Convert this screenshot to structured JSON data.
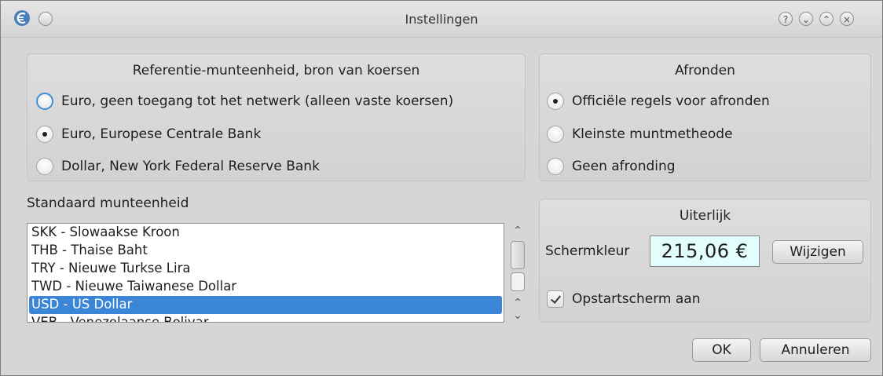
{
  "window": {
    "title": "Instellingen"
  },
  "titlebar_buttons": [
    {
      "name": "help",
      "glyph": "?"
    },
    {
      "name": "minimize",
      "glyph": "⌄"
    },
    {
      "name": "maximize",
      "glyph": "⌃"
    },
    {
      "name": "close",
      "glyph": "×"
    }
  ],
  "reference_group": {
    "title": "Referentie-munteenheid, bron van koersen",
    "options": [
      {
        "label": "Euro, geen toegang tot het netwerk (alleen vaste koersen)",
        "checked": false,
        "focused": true
      },
      {
        "label": "Euro, Europese Centrale Bank",
        "checked": true,
        "focused": false
      },
      {
        "label": "Dollar, New York Federal Reserve Bank",
        "checked": false,
        "focused": false
      }
    ]
  },
  "rounding_group": {
    "title": "Afronden",
    "options": [
      {
        "label": "Officiële regels voor afronden",
        "checked": true
      },
      {
        "label": "Kleinste muntmetheode",
        "checked": false
      },
      {
        "label": "Geen afronding",
        "checked": false
      }
    ]
  },
  "default_currency": {
    "label": "Standaard munteenheid",
    "items": [
      "SKK - Slowaakse Kroon",
      "THB - Thaise Baht",
      "TRY - Nieuwe Turkse Lira",
      "TWD - Nieuwe Taiwanese Dollar",
      "USD - US Dollar",
      "VEB - Venezolaanse Bolivar"
    ],
    "selected": "USD - US Dollar"
  },
  "appearance_group": {
    "title": "Uiterlijk",
    "screen_color_label": "Schermkleur",
    "preview_value": "215,06 €",
    "preview_background": "#e3fcfc",
    "change_button": "Wijzigen",
    "splash_label": "Opstartscherm aan",
    "splash_checked": true
  },
  "dialog_buttons": {
    "ok": "OK",
    "cancel": "Annuleren"
  },
  "colors": {
    "accent": "#3b85d6",
    "focus_ring": "#3f8ed6"
  }
}
